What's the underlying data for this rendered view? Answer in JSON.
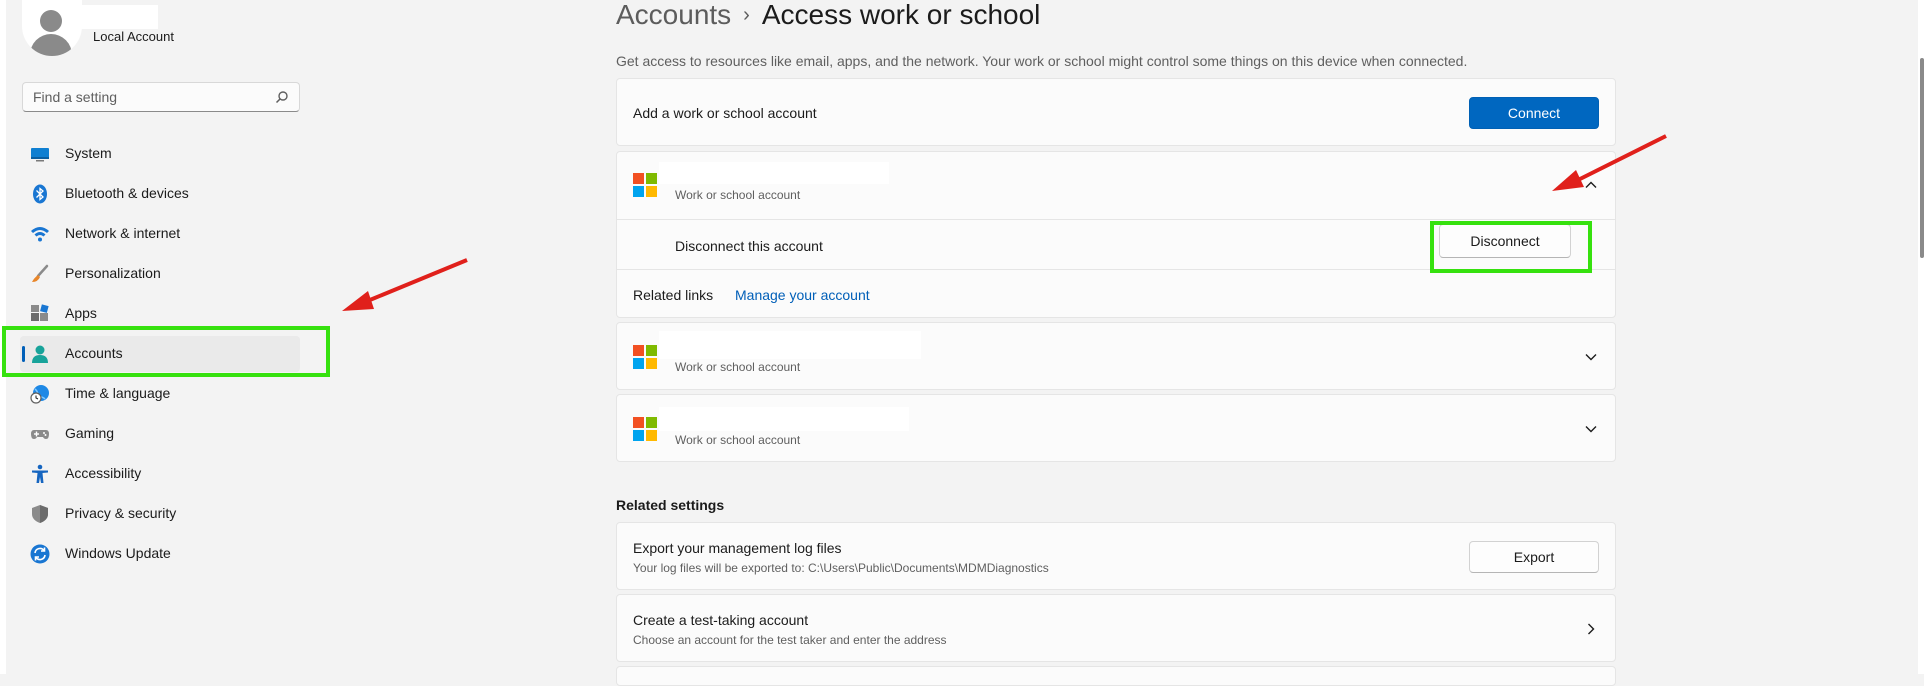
{
  "user": {
    "account_type": "Local Account"
  },
  "search": {
    "placeholder": "Find a setting"
  },
  "nav": {
    "items": [
      {
        "label": "System",
        "icon": "system-icon"
      },
      {
        "label": "Bluetooth & devices",
        "icon": "bluetooth-icon"
      },
      {
        "label": "Network & internet",
        "icon": "wifi-icon"
      },
      {
        "label": "Personalization",
        "icon": "brush-icon"
      },
      {
        "label": "Apps",
        "icon": "apps-icon"
      },
      {
        "label": "Accounts",
        "icon": "accounts-icon",
        "selected": true
      },
      {
        "label": "Time & language",
        "icon": "globe-clock-icon"
      },
      {
        "label": "Gaming",
        "icon": "gamepad-icon"
      },
      {
        "label": "Accessibility",
        "icon": "accessibility-icon"
      },
      {
        "label": "Privacy & security",
        "icon": "shield-icon"
      },
      {
        "label": "Windows Update",
        "icon": "update-icon"
      }
    ]
  },
  "header": {
    "root": "Accounts",
    "separator": "›",
    "current": "Access work or school",
    "description": "Get access to resources like email, apps, and the network. Your work or school might control some things on this device when connected."
  },
  "add_account": {
    "label": "Add a work or school account",
    "button": "Connect"
  },
  "accounts": [
    {
      "subtitle": "Work or school account",
      "expanded": true
    },
    {
      "subtitle": "Work or school account",
      "expanded": false
    },
    {
      "subtitle": "Work or school account",
      "expanded": false
    }
  ],
  "expanded_panel": {
    "disconnect_label": "Disconnect this account",
    "disconnect_button": "Disconnect",
    "related_links_label": "Related links",
    "manage_link": "Manage your account"
  },
  "related_settings": {
    "heading": "Related settings",
    "export": {
      "title": "Export your management log files",
      "subtitle": "Your log files will be exported to: C:\\Users\\Public\\Documents\\MDMDiagnostics",
      "button": "Export"
    },
    "test_account": {
      "title": "Create a test-taking account",
      "subtitle": "Choose an account for the test taker and enter the address"
    }
  },
  "colors": {
    "accent": "#0067c0",
    "highlight": "#36e10e",
    "annotation_arrow": "#e0201b",
    "ms_red": "#f25022",
    "ms_green": "#7fba00",
    "ms_blue": "#00a4ef",
    "ms_yellow": "#ffb900"
  }
}
